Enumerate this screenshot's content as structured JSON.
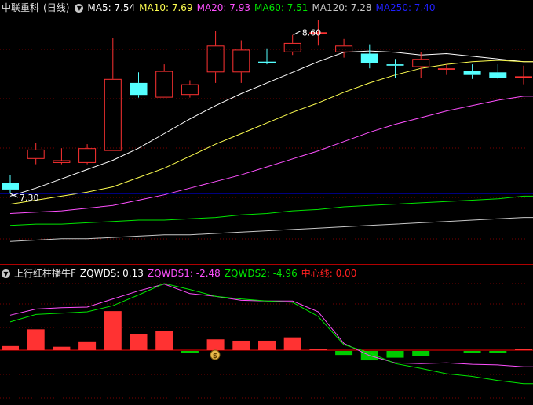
{
  "main_legend": {
    "stock": "中联重科",
    "period": "(日线)",
    "dropdown_icon": "chevron-down-icon",
    "ma5": "MA5: 7.54",
    "ma10": "MA10: 7.69",
    "ma20": "MA20: 7.93",
    "ma60": "MA60: 7.51",
    "ma120": "MA120: 7.28",
    "ma250": "MA250: 7.40"
  },
  "sub_legend": {
    "name": "上行红柱播牛F",
    "zqwds": "ZQWDS: 0.13",
    "zqwds1": "ZQWDS1: -2.48",
    "zqwds2": "ZQWDS2: -4.96",
    "center": "中心线: 0.00",
    "dropdown_icon": "chevron-down-icon"
  },
  "annotations": {
    "high": "8.60",
    "low": "7.30"
  },
  "colors": {
    "up": "#ff3232",
    "down": "#54ffff",
    "ma5": "#ffffff",
    "ma10": "#ffff50",
    "ma20": "#ff50ff",
    "ma60": "#00e600",
    "ma120": "#c8c8c8",
    "ma250": "#0000ff",
    "zq1": "#ff50ff",
    "zq2": "#00e600",
    "center": "#ff0000"
  },
  "chart_data": [
    {
      "type": "candlestick",
      "x_index": [
        1,
        2,
        3,
        4,
        5,
        6,
        7,
        8,
        9,
        10,
        11,
        12,
        13,
        14,
        15,
        16,
        17,
        18,
        19,
        20,
        21
      ],
      "open": [
        7.38,
        7.56,
        7.53,
        7.53,
        7.62,
        8.13,
        8.02,
        8.04,
        8.21,
        8.21,
        8.29,
        8.36,
        8.5,
        8.36,
        8.35,
        8.27,
        8.25,
        8.23,
        8.22,
        8.21,
        8.17
      ],
      "close": [
        7.33,
        7.63,
        7.55,
        7.64,
        8.16,
        8.04,
        8.22,
        8.12,
        8.41,
        8.38,
        8.28,
        8.43,
        8.51,
        8.41,
        8.28,
        8.26,
        8.31,
        8.24,
        8.19,
        8.17,
        8.18
      ],
      "high": [
        7.44,
        7.68,
        7.64,
        7.67,
        8.47,
        8.21,
        8.27,
        8.15,
        8.52,
        8.45,
        8.39,
        8.49,
        8.6,
        8.46,
        8.42,
        8.31,
        8.36,
        8.27,
        8.27,
        8.27,
        8.26
      ],
      "low": [
        7.3,
        7.52,
        7.52,
        7.52,
        7.62,
        8.02,
        8.02,
        8.02,
        8.13,
        8.13,
        8.27,
        8.34,
        8.41,
        8.32,
        8.24,
        8.17,
        8.17,
        8.19,
        8.16,
        8.16,
        8.12
      ],
      "series": [
        {
          "name": "MA5",
          "values": [
            7.28,
            7.34,
            7.41,
            7.48,
            7.55,
            7.64,
            7.75,
            7.86,
            7.96,
            8.05,
            8.13,
            8.21,
            8.29,
            8.36,
            8.37,
            8.36,
            8.34,
            8.35,
            8.33,
            8.31,
            8.29
          ]
        },
        {
          "name": "MA10",
          "values": [
            7.22,
            7.25,
            7.28,
            7.31,
            7.35,
            7.42,
            7.49,
            7.58,
            7.67,
            7.75,
            7.83,
            7.91,
            7.98,
            8.06,
            8.13,
            8.19,
            8.24,
            8.27,
            8.29,
            8.3,
            8.29
          ]
        },
        {
          "name": "MA20",
          "values": [
            7.15,
            7.16,
            7.17,
            7.19,
            7.21,
            7.25,
            7.29,
            7.34,
            7.39,
            7.44,
            7.5,
            7.56,
            7.62,
            7.69,
            7.76,
            7.82,
            7.87,
            7.92,
            7.96,
            8.0,
            8.03
          ]
        },
        {
          "name": "MA60",
          "values": [
            7.06,
            7.07,
            7.07,
            7.08,
            7.09,
            7.1,
            7.1,
            7.11,
            7.12,
            7.14,
            7.15,
            7.17,
            7.18,
            7.2,
            7.21,
            7.22,
            7.23,
            7.24,
            7.25,
            7.26,
            7.28
          ]
        },
        {
          "name": "MA120",
          "values": [
            6.94,
            6.95,
            6.96,
            6.96,
            6.97,
            6.98,
            6.99,
            6.99,
            7.0,
            7.01,
            7.02,
            7.03,
            7.04,
            7.05,
            7.06,
            7.07,
            7.08,
            7.09,
            7.1,
            7.11,
            7.12
          ]
        },
        {
          "name": "MA250",
          "values": [
            7.3,
            7.3,
            7.3,
            7.3,
            7.3,
            7.3,
            7.3,
            7.3,
            7.3,
            7.3,
            7.3,
            7.3,
            7.3,
            7.3,
            7.3,
            7.3,
            7.3,
            7.3,
            7.3,
            7.3,
            7.3
          ]
        }
      ]
    },
    {
      "type": "bar",
      "name": "ZQWDS",
      "x_index": [
        1,
        2,
        3,
        4,
        5,
        6,
        7,
        8,
        9,
        10,
        11,
        12,
        13,
        14,
        15,
        16,
        17,
        18,
        19,
        20,
        21
      ],
      "values": [
        0.6,
        3.1,
        0.5,
        1.3,
        5.8,
        2.4,
        2.9,
        -0.3,
        1.6,
        1.4,
        1.4,
        1.9,
        0.2,
        -0.6,
        -1.4,
        -1.0,
        -0.8,
        0.0,
        -0.3,
        -0.3,
        0.13
      ],
      "series": [
        {
          "name": "ZQWDS1",
          "values": [
            5.2,
            6.1,
            6.3,
            6.4,
            7.6,
            8.8,
            9.8,
            8.4,
            8.0,
            7.4,
            7.3,
            7.3,
            5.7,
            1.0,
            -0.8,
            -1.9,
            -2.0,
            -1.9,
            -2.1,
            -2.2,
            -2.48
          ]
        },
        {
          "name": "ZQWDS2",
          "values": [
            4.2,
            5.3,
            5.5,
            5.7,
            6.6,
            8.2,
            9.9,
            9.0,
            8.0,
            7.6,
            7.3,
            7.1,
            5.0,
            0.8,
            -0.4,
            -2.0,
            -2.7,
            -3.5,
            -3.9,
            -4.5,
            -4.96
          ]
        }
      ]
    }
  ]
}
